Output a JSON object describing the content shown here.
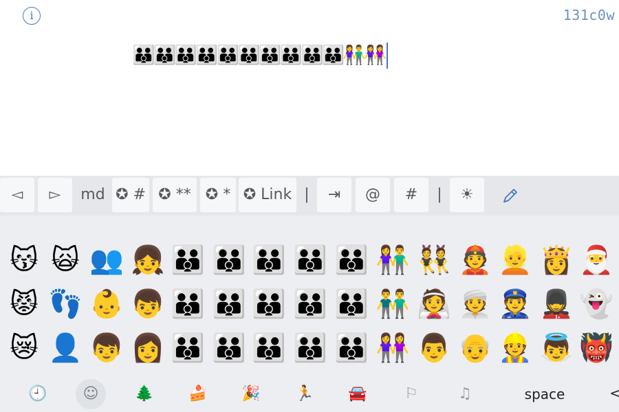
{
  "header": {
    "info_icon_glyph": "i",
    "counter": "131c0w"
  },
  "document": {
    "typed_text": "👪👪👪👪👪👪👪👪👪👪👫👭"
  },
  "toolbar": {
    "keys": [
      "◅",
      "▻",
      "md",
      "✪ #",
      "✪ **",
      "✪ *",
      "✪ Link",
      "|",
      "⇥",
      "@",
      "#",
      "|",
      "☀"
    ],
    "pencil_icon": "pencil-icon"
  },
  "emoji_grid": {
    "rows": [
      [
        "😽",
        "🙀",
        "👥",
        "👧",
        "👪",
        "👪",
        "👪",
        "👪",
        "👪",
        "👫",
        "👯",
        "👲",
        "👱",
        "👸",
        "🎅"
      ],
      [
        "😾",
        "👣",
        "👶",
        "👦",
        "👪",
        "👪",
        "👪",
        "👪",
        "👪",
        "👬",
        "👰",
        "👳",
        "👮",
        "💂",
        "👻"
      ],
      [
        "😿",
        "👤",
        "👦",
        "👩",
        "👪",
        "👪",
        "👪",
        "👪",
        "👪",
        "👭",
        "👨",
        "👴",
        "👷",
        "👼",
        "👹"
      ]
    ]
  },
  "categories": {
    "icons": [
      "recent-clock-icon",
      "smileys-icon",
      "nature-tree-icon",
      "food-icon",
      "celebration-icon",
      "activity-runner-icon",
      "travel-icon",
      "flags-icon",
      "symbols-icon"
    ],
    "glyphs": [
      "🕘",
      "☺",
      "🌲",
      "🍰",
      "🎉",
      "🏃",
      "🚘",
      "⚐",
      "♫"
    ],
    "active_index": 1,
    "space_label": "space",
    "back_glyph": "<"
  }
}
